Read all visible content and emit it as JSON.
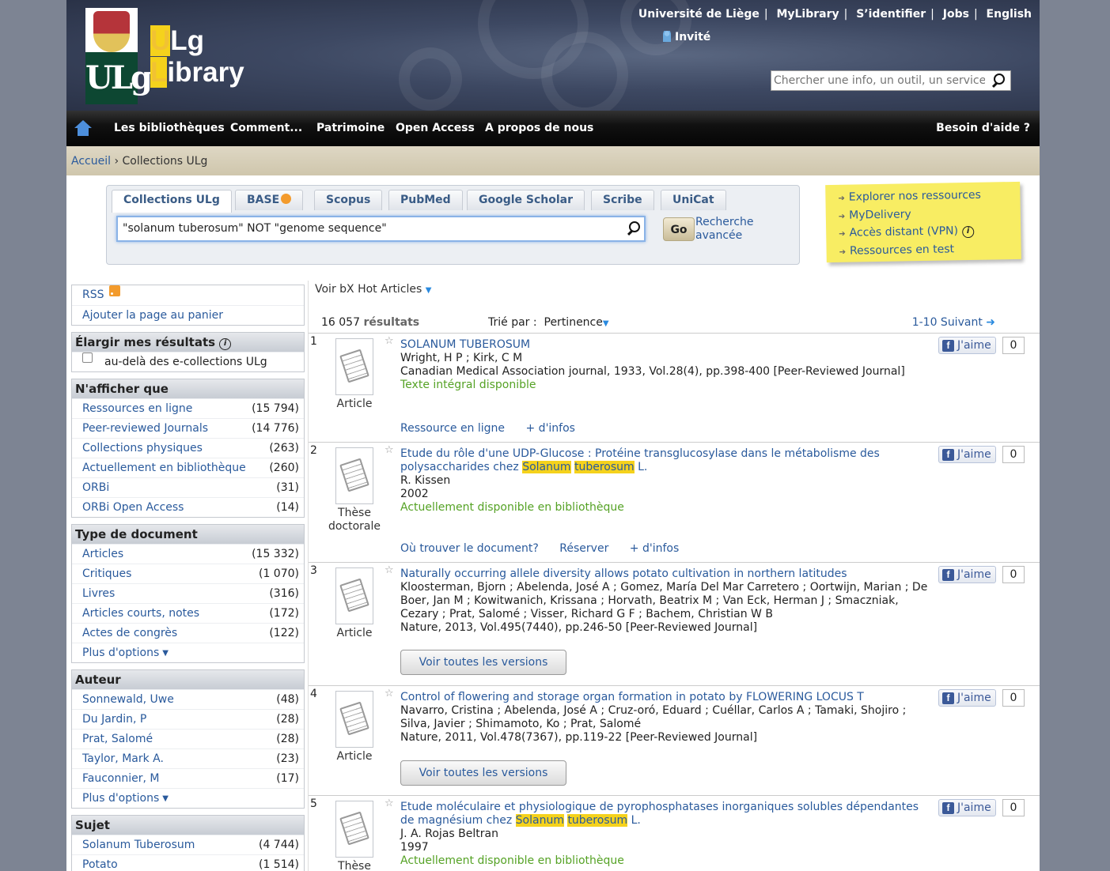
{
  "header": {
    "logo_ulg_top": "U",
    "logo_ulg_rest": "Lg",
    "logo_lib_first": "L",
    "logo_lib_rest": "ibrary",
    "logo_emblem": "ULg",
    "top_links": [
      "Université de Liège",
      "MyLibrary",
      "S’identifier",
      "Jobs",
      "English"
    ],
    "guest": "Invité",
    "site_search_placeholder": "Chercher une info, un outil, un service..."
  },
  "nav": {
    "items": [
      "Les bibliothèques",
      "Comment...",
      "Patrimoine",
      "Open Access",
      "A propos de nous"
    ],
    "help": "Besoin d'aide ?"
  },
  "breadcrumb": {
    "home": "Accueil",
    "sep": "›",
    "current": "Collections ULg"
  },
  "search": {
    "tabs": [
      "Collections ULg",
      "BASE",
      "Scopus",
      "PubMed",
      "Google Scholar",
      "Scribe",
      "UniCat"
    ],
    "query": "\"solanum tuberosum\" NOT \"genome sequence\"",
    "go": "Go",
    "advanced_1": "Recherche",
    "advanced_2": "avancée"
  },
  "sticky": {
    "items": [
      "Explorer nos ressources",
      "MyDelivery",
      "Accès distant (VPN)",
      "Ressources en test"
    ]
  },
  "sidebar": {
    "rss": "RSS",
    "add_to_cart": "Ajouter la page au panier",
    "broaden_title": "Élargir mes résultats",
    "broaden_option": "au-delà des e-collections ULg",
    "show_only_title": "N'afficher que",
    "show_only": [
      {
        "label": "Ressources en ligne",
        "count": "(15 794)"
      },
      {
        "label": "Peer-reviewed Journals",
        "count": "(14 776)"
      },
      {
        "label": "Collections physiques",
        "count": "(263)"
      },
      {
        "label": "Actuellement en bibliothèque",
        "count": "(260)"
      },
      {
        "label": "ORBi",
        "count": "(31)"
      },
      {
        "label": "ORBi Open Access",
        "count": "(14)"
      }
    ],
    "doctype_title": "Type de document",
    "doctype": [
      {
        "label": "Articles",
        "count": "(15 332)"
      },
      {
        "label": "Critiques",
        "count": "(1 070)"
      },
      {
        "label": "Livres",
        "count": "(316)"
      },
      {
        "label": "Articles courts, notes",
        "count": "(172)"
      },
      {
        "label": "Actes de congrès",
        "count": "(122)"
      }
    ],
    "more_options": "Plus d'options",
    "author_title": "Auteur",
    "authors": [
      {
        "label": "Sonnewald, Uwe",
        "count": "(48)"
      },
      {
        "label": "Du Jardin, P",
        "count": "(28)"
      },
      {
        "label": "Prat, Salomé",
        "count": "(28)"
      },
      {
        "label": "Taylor, Mark A.",
        "count": "(23)"
      },
      {
        "label": "Fauconnier, M",
        "count": "(17)"
      }
    ],
    "subject_title": "Sujet",
    "subjects": [
      {
        "label": "Solanum Tuberosum",
        "count": "(4 744)"
      },
      {
        "label": "Potato",
        "count": "(1 514)"
      }
    ]
  },
  "results": {
    "hot_articles": "Voir bX Hot Articles",
    "count": "16 057",
    "count_label": "résultats",
    "sort_label": "Trié par :",
    "sort_value": "Pertinence",
    "paging": "1-10 Suivant",
    "like": "J'aime",
    "like_count": "0",
    "versions": "Voir toutes les versions",
    "items": [
      {
        "num": "1",
        "type": "Article",
        "title": "SOLANUM TUBEROSUM",
        "authors": "Wright, H P ; Kirk, C M",
        "source": "Canadian Medical Association journal, 1933, Vol.28(4), pp.398-400 [Peer-Reviewed Journal]",
        "availability": "Texte intégral disponible",
        "links": [
          "Ressource en ligne",
          "+ d'infos"
        ]
      },
      {
        "num": "2",
        "type_1": "Thèse",
        "type_2": "doctorale",
        "title_before": "Etude du rôle d'une UDP-Glucose : Protéine transglucosylase dans le métabolisme des polysaccharides chez ",
        "hl_1": "Solanum",
        "hl_2": "tuberosum",
        "title_after": " L.",
        "authors": "R. Kissen",
        "year": "2002",
        "availability": "Actuellement disponible en bibliothèque",
        "links": [
          "Où trouver le document?",
          "Réserver",
          "+ d'infos"
        ]
      },
      {
        "num": "3",
        "type": "Article",
        "title": "Naturally occurring allele diversity allows potato cultivation in northern latitudes",
        "authors": "Kloosterman, Bjorn ; Abelenda, José A ; Gomez, María Del Mar Carretero ; Oortwijn, Marian ; De Boer, Jan M ; Kowitwanich, Krissana ; Horvath, Beatrix M ; Van Eck, Herman J ; Smaczniak, Cezary ; Prat, Salomé ; Visser, Richard G F ; Bachem, Christian W B",
        "source": "Nature, 2013, Vol.495(7440), pp.246-50 [Peer-Reviewed Journal]"
      },
      {
        "num": "4",
        "type": "Article",
        "title": "Control of flowering and storage organ formation in potato by FLOWERING LOCUS T",
        "authors": "Navarro, Cristina ; Abelenda, José A ; Cruz-oró, Eduard ; Cuéllar, Carlos A ; Tamaki, Shojiro ; Silva, Javier ; Shimamoto, Ko ; Prat, Salomé",
        "source": "Nature, 2011, Vol.478(7367), pp.119-22 [Peer-Reviewed Journal]"
      },
      {
        "num": "5",
        "type_1": "Thèse",
        "title_before": "Etude moléculaire et physiologique de pyrophosphatases inorganiques solubles dépendantes de magnésium chez ",
        "hl_1": "Solanum",
        "hl_2": "tuberosum",
        "title_after": " L.",
        "authors": "J. A. Rojas Beltran",
        "year": "1997",
        "availability": "Actuellement disponible en bibliothèque"
      }
    ]
  }
}
